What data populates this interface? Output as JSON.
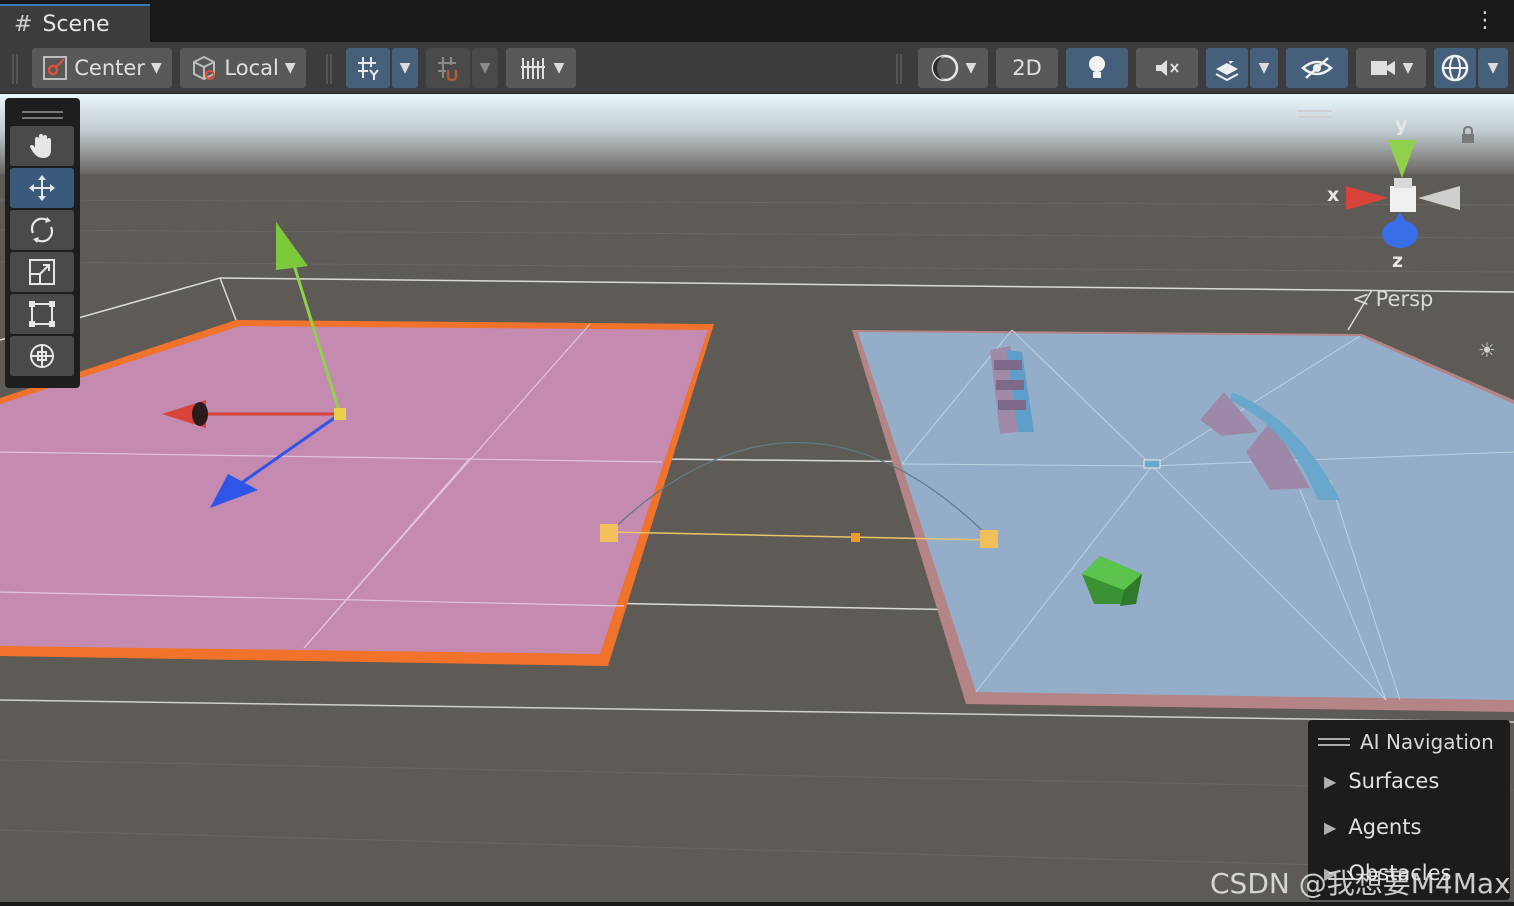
{
  "window": {
    "tab_title": "Scene"
  },
  "toolbar": {
    "pivot_label": "Center",
    "space_label": "Local",
    "mode_2d_label": "2D"
  },
  "tools": [
    "hand-tool",
    "move-tool",
    "rotate-tool",
    "scale-tool",
    "rect-tool",
    "transform-tool"
  ],
  "active_tool": "move-tool",
  "gizmo": {
    "x_label": "x",
    "y_label": "y",
    "z_label": "z",
    "projection_label": "Persp"
  },
  "ai_navigation": {
    "title": "AI Navigation",
    "items": [
      "Surfaces",
      "Agents",
      "Obstacles"
    ]
  },
  "watermark": "CSDN @我想要M4Max",
  "colors": {
    "selected_plane": "#c48aaf",
    "selection_outline": "#f0722b",
    "navmesh_plane": "#94aec9",
    "axis_x": "#d9443a",
    "axis_y": "#8fd14c",
    "axis_z": "#2f55e8",
    "green_cube": "#47a83a",
    "active_button": "#46607c"
  }
}
